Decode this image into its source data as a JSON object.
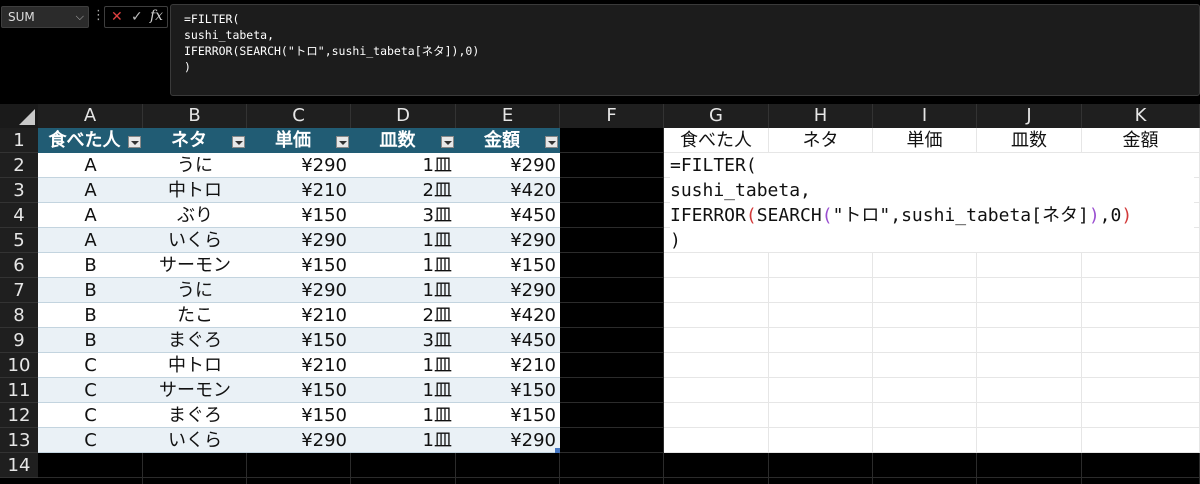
{
  "formula_bar": {
    "name_box": "SUM",
    "formula_lines": [
      "=FILTER(",
      "sushi_tabeta,",
      "IFERROR(SEARCH(\"トロ\",sushi_tabeta[ネタ]),0)",
      ")"
    ]
  },
  "columns": [
    "A",
    "B",
    "C",
    "D",
    "E",
    "F",
    "G",
    "H",
    "I",
    "J",
    "K"
  ],
  "rows": [
    "1",
    "2",
    "3",
    "4",
    "5",
    "6",
    "7",
    "8",
    "9",
    "10",
    "11",
    "12",
    "13",
    "14"
  ],
  "table": {
    "name": "sushi_tabeta",
    "headers": [
      "食べた人",
      "ネタ",
      "単価",
      "皿数",
      "金額"
    ],
    "rows": [
      [
        "A",
        "うに",
        "¥290",
        "1皿",
        "¥290"
      ],
      [
        "A",
        "中トロ",
        "¥210",
        "2皿",
        "¥420"
      ],
      [
        "A",
        "ぶり",
        "¥150",
        "3皿",
        "¥450"
      ],
      [
        "A",
        "いくら",
        "¥290",
        "1皿",
        "¥290"
      ],
      [
        "B",
        "サーモン",
        "¥150",
        "1皿",
        "¥150"
      ],
      [
        "B",
        "うに",
        "¥290",
        "1皿",
        "¥290"
      ],
      [
        "B",
        "たこ",
        "¥210",
        "2皿",
        "¥420"
      ],
      [
        "B",
        "まぐろ",
        "¥150",
        "3皿",
        "¥450"
      ],
      [
        "C",
        "中トロ",
        "¥210",
        "1皿",
        "¥210"
      ],
      [
        "C",
        "サーモン",
        "¥150",
        "1皿",
        "¥150"
      ],
      [
        "C",
        "まぐろ",
        "¥150",
        "1皿",
        "¥150"
      ],
      [
        "C",
        "いくら",
        "¥290",
        "1皿",
        "¥290"
      ]
    ]
  },
  "output_headers": [
    "食べた人",
    "ネタ",
    "単価",
    "皿数",
    "金額"
  ],
  "cell_edit": {
    "line1": "=FILTER(",
    "line2": "sushi_tabeta,",
    "line3_a": "IFERROR",
    "line3_p1": "(",
    "line3_b": "SEARCH",
    "line3_p2": "(",
    "line3_c": "\"トロ\",sushi_tabeta[ネタ]",
    "line3_p3": ")",
    "line3_d": ",0",
    "line3_p4": ")",
    "line4": ")"
  },
  "colors": {
    "table_header": "#215c74",
    "band_light": "#eaf1f6",
    "cancel_red": "#e04040"
  },
  "icons": [
    "chevron-down-icon",
    "cancel-icon",
    "checkmark-icon",
    "fx-icon",
    "filter-dropdown-icon",
    "select-all-icon"
  ]
}
